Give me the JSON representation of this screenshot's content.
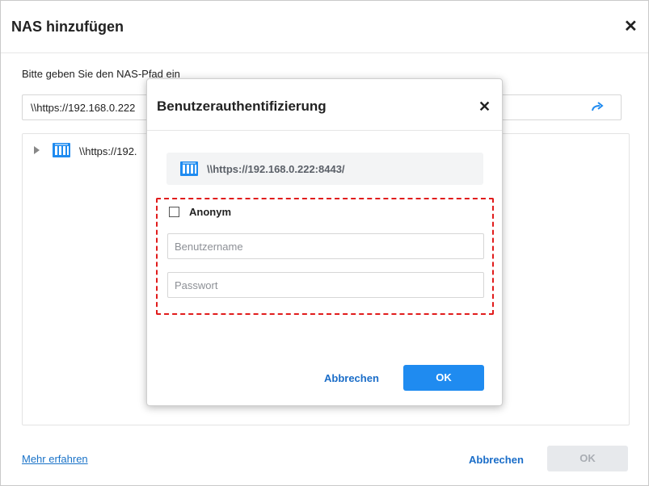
{
  "outer": {
    "title": "NAS hinzufügen",
    "close_glyph": "✕",
    "path_label": "Bitte geben Sie den NAS-Pfad ein",
    "path_value": "\\\\https://192.168.0.222",
    "go_icon": "arrow-right-icon",
    "tree_item_label": "\\\\https://192.",
    "more_link": "Mehr erfahren",
    "cancel_label": "Abbrechen",
    "ok_label": "OK"
  },
  "auth": {
    "title": "Benutzerauthentifizierung",
    "close_glyph": "✕",
    "server_path": "\\\\https://192.168.0.222:8443/",
    "anonymous_label": "Anonym",
    "anonymous_checked": false,
    "username_placeholder": "Benutzername",
    "password_placeholder": "Passwort",
    "cancel_label": "Abbrechen",
    "ok_label": "OK"
  },
  "colors": {
    "accent": "#1f8bf0",
    "link": "#1a6dc8",
    "highlight": "#e11c1c",
    "disabled_bg": "#e7e9ec"
  }
}
